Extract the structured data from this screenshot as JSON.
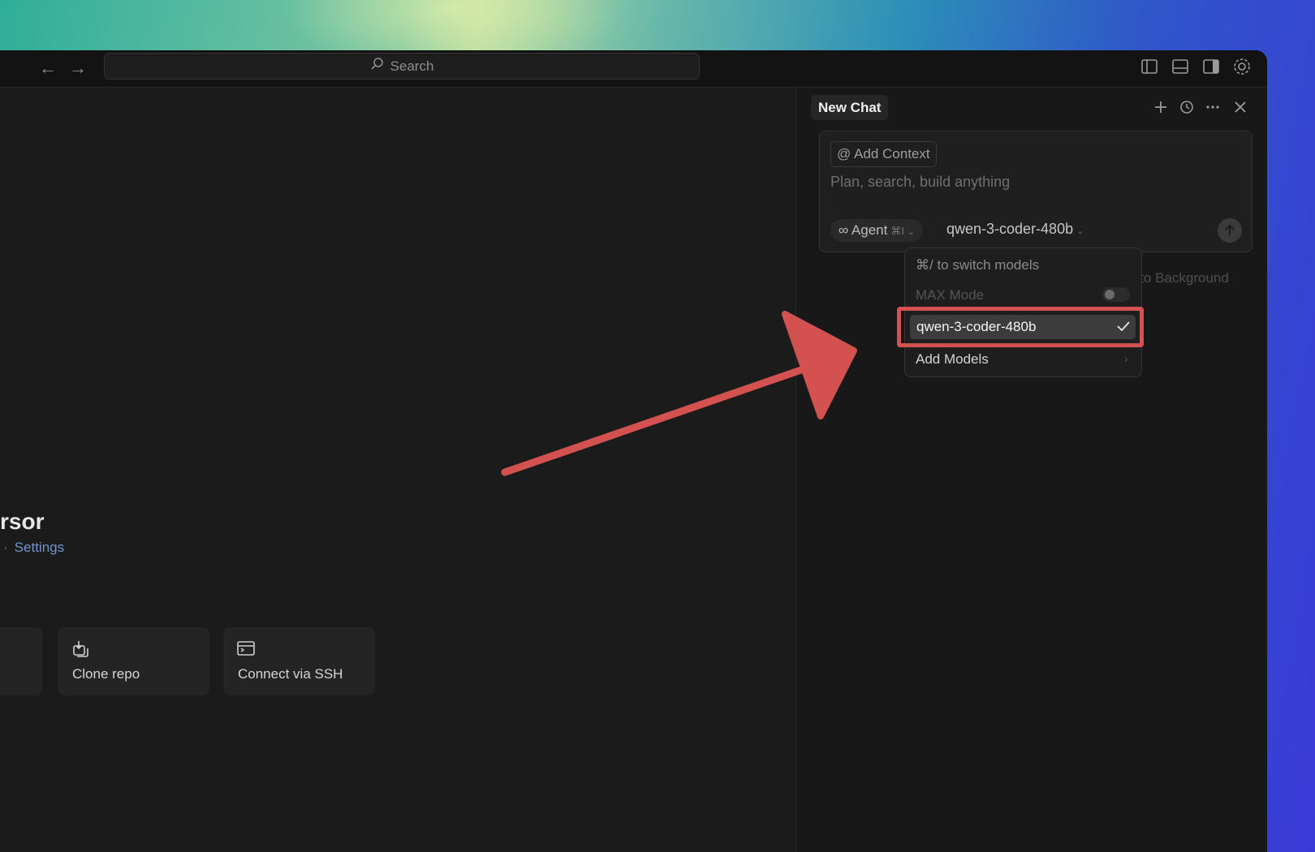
{
  "titlebar": {
    "back_icon": "arrow-left-icon",
    "forward_icon": "arrow-right-icon",
    "search_label": "Search",
    "icons": [
      "toggle-sidebar-icon",
      "toggle-panel-icon",
      "toggle-secondary-sidebar-icon",
      "settings-gear-icon"
    ]
  },
  "welcome": {
    "title": "rsor",
    "links_separator": "·",
    "settings_link": "Settings",
    "actions": [
      {
        "label": "Clone repo",
        "icon": "clone-repo-icon"
      },
      {
        "label": "Connect via SSH",
        "icon": "terminal-window-icon"
      }
    ]
  },
  "chat": {
    "tab_title": "New Chat",
    "header_icons": [
      "plus-icon",
      "history-icon",
      "more-icon",
      "close-icon"
    ],
    "add_context_label": "@ Add Context",
    "placeholder": "Plan, search, build anything",
    "mode": {
      "icon": "infinity-icon",
      "label": "Agent",
      "shortcut": "⌘I"
    },
    "model": "qwen-3-coder-480b",
    "send_icon": "arrow-up-icon",
    "background_hint": "d to Background"
  },
  "model_dropdown": {
    "hint": "⌘/ to switch models",
    "max_mode_label": "MAX Mode",
    "max_mode_on": false,
    "selected_model": "qwen-3-coder-480b",
    "add_models_label": "Add Models"
  },
  "annotation": {
    "color": "#d3524f",
    "shape": "arrow-and-highlight-box"
  }
}
